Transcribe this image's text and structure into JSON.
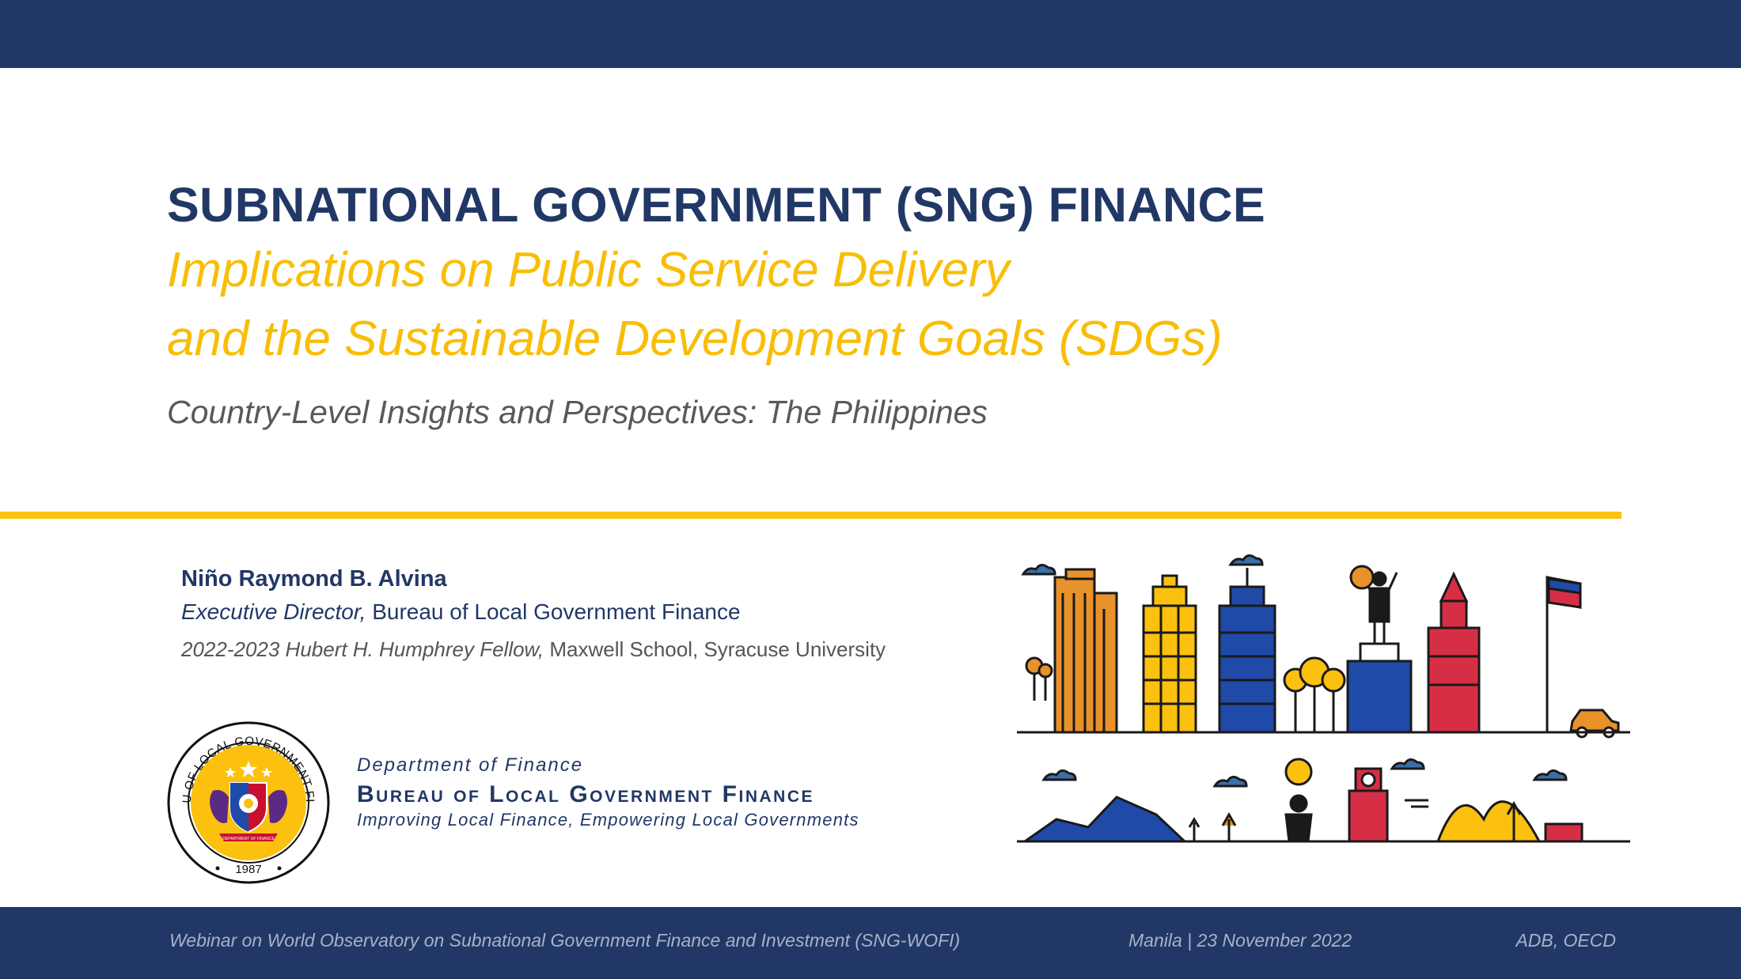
{
  "title": "SUBNATIONAL GOVERNMENT (SNG) FINANCE",
  "subtitle_line1": "Implications on Public Service Delivery",
  "subtitle_line2": "and the Sustainable Development Goals (SDGs)",
  "subtitle_line3": "Country-Level Insights and Perspectives: The Philippines",
  "presenter": {
    "name": "Niño Raymond B. Alvina",
    "role_italic": "Executive Director,",
    "role_org": "Bureau of Local Government Finance",
    "fellowship_italic": "2022-2023 Hubert H. Humphrey Fellow,",
    "fellowship_org": "Maxwell School, Syracuse University"
  },
  "seal": {
    "ring_text": "BUREAU OF LOCAL GOVERNMENT FINANCE",
    "year": "1987",
    "ribbon_text": "DEPARTMENT OF FINANCE"
  },
  "org": {
    "department": "Department of Finance",
    "bureau": "Bureau of Local Government Finance",
    "tagline": "Improving Local Finance, Empowering Local Governments"
  },
  "footer": {
    "event": "Webinar on World Observatory on Subnational Government Finance and Investment (SNG-WOFI)",
    "place_date": "Manila | 23 November 2022",
    "partners": "ADB, OECD"
  },
  "colors": {
    "navy": "#213866",
    "gold": "#f8be07",
    "gray": "#595959"
  },
  "icons": [
    "seal-logo",
    "cityscape-illustration"
  ]
}
